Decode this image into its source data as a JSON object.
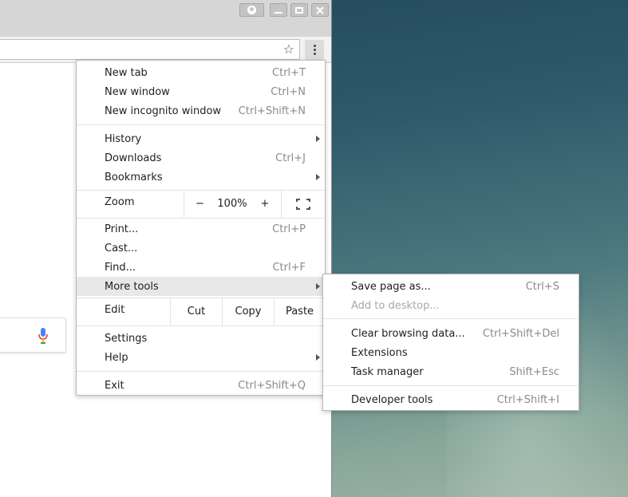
{
  "main_menu": {
    "new_tab": {
      "label": "New tab",
      "shortcut": "Ctrl+T"
    },
    "new_window": {
      "label": "New window",
      "shortcut": "Ctrl+N"
    },
    "new_incognito": {
      "label": "New incognito window",
      "shortcut": "Ctrl+Shift+N"
    },
    "history": {
      "label": "History"
    },
    "downloads": {
      "label": "Downloads",
      "shortcut": "Ctrl+J"
    },
    "bookmarks": {
      "label": "Bookmarks"
    },
    "zoom": {
      "label": "Zoom",
      "minus": "−",
      "value": "100%",
      "plus": "+"
    },
    "print": {
      "label": "Print...",
      "shortcut": "Ctrl+P"
    },
    "cast": {
      "label": "Cast..."
    },
    "find": {
      "label": "Find...",
      "shortcut": "Ctrl+F"
    },
    "more_tools": {
      "label": "More tools"
    },
    "edit": {
      "label": "Edit",
      "cut": "Cut",
      "copy": "Copy",
      "paste": "Paste"
    },
    "settings": {
      "label": "Settings"
    },
    "help": {
      "label": "Help"
    },
    "exit": {
      "label": "Exit",
      "shortcut": "Ctrl+Shift+Q"
    }
  },
  "more_tools_menu": {
    "save_page": {
      "label": "Save page as...",
      "shortcut": "Ctrl+S"
    },
    "add_to_desktop": {
      "label": "Add to desktop..."
    },
    "clear_browsing": {
      "label": "Clear browsing data...",
      "shortcut": "Ctrl+Shift+Del"
    },
    "extensions": {
      "label": "Extensions"
    },
    "task_manager": {
      "label": "Task manager",
      "shortcut": "Shift+Esc"
    },
    "developer_tools": {
      "label": "Developer tools",
      "shortcut": "Ctrl+Shift+I"
    }
  },
  "icons": {
    "star": "star-icon",
    "menu": "three-dot-menu-icon",
    "mic": "microphone-icon",
    "fullscreen": "fullscreen-icon"
  },
  "colors": {
    "menu_highlight": "#e8e8e8",
    "shortcut_text": "#8a8a8a",
    "disabled_text": "#a8a8a8"
  }
}
